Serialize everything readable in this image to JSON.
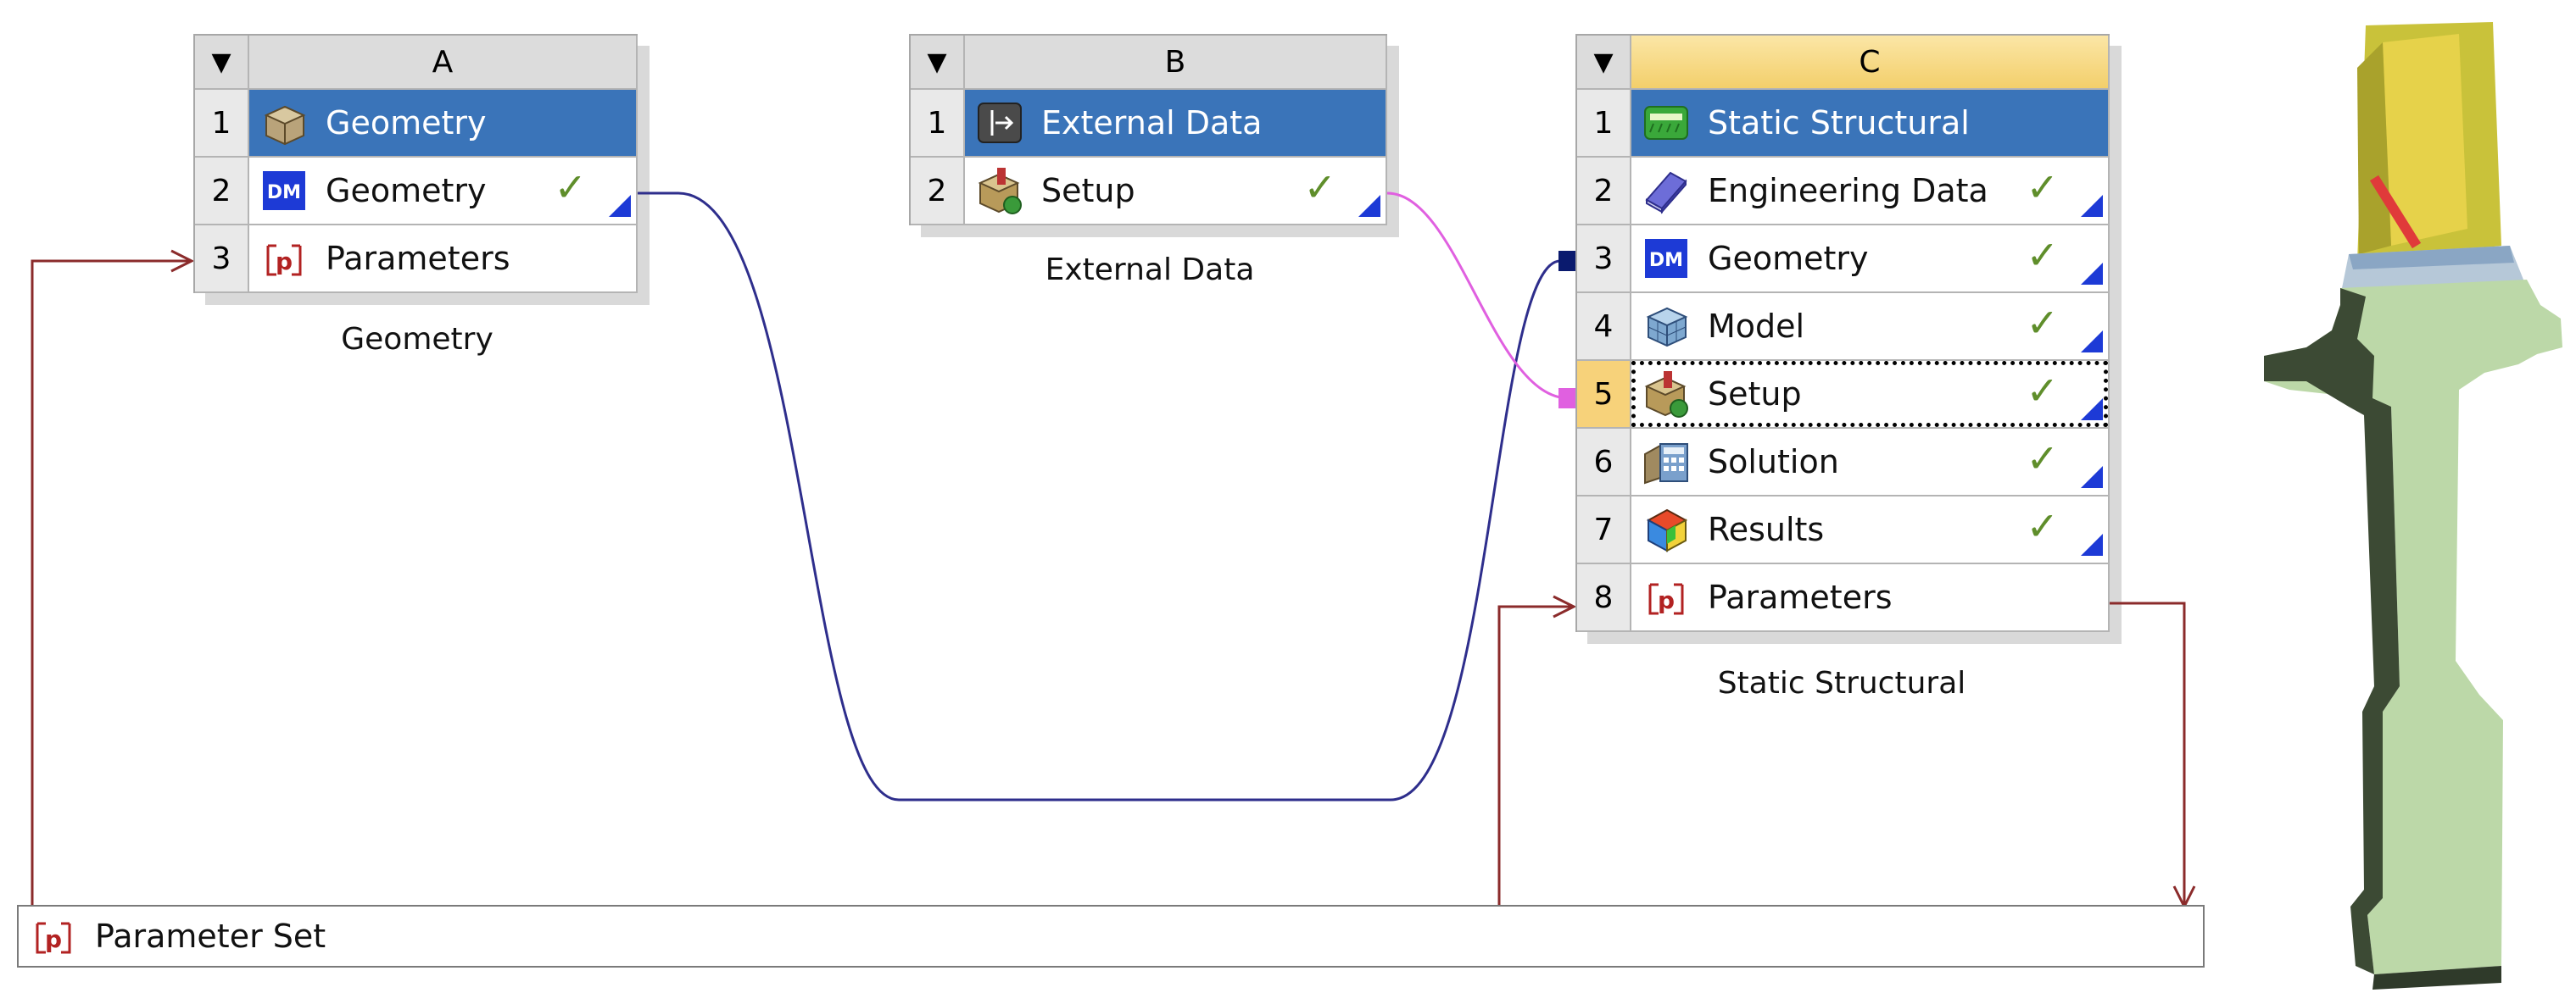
{
  "systems": {
    "a": {
      "letter": "A",
      "caption": "Geometry",
      "rows": [
        {
          "num": "1",
          "label": "Geometry",
          "icon": "geometry-box-icon"
        },
        {
          "num": "2",
          "label": "Geometry",
          "icon": "designmodeler-dm-icon",
          "status": "✓"
        },
        {
          "num": "3",
          "label": "Parameters",
          "icon": "parameters-icon"
        }
      ]
    },
    "b": {
      "letter": "B",
      "caption": "External Data",
      "rows": [
        {
          "num": "1",
          "label": "External Data",
          "icon": "external-data-icon"
        },
        {
          "num": "2",
          "label": "Setup",
          "icon": "setup-icon",
          "status": "✓"
        }
      ]
    },
    "c": {
      "letter": "C",
      "caption": "Static Structural",
      "rows": [
        {
          "num": "1",
          "label": "Static Structural",
          "icon": "static-structural-icon"
        },
        {
          "num": "2",
          "label": "Engineering Data",
          "icon": "engineering-data-book-icon",
          "status": "✓"
        },
        {
          "num": "3",
          "label": "Geometry",
          "icon": "designmodeler-dm-icon",
          "status": "✓"
        },
        {
          "num": "4",
          "label": "Model",
          "icon": "model-mesh-icon",
          "status": "✓"
        },
        {
          "num": "5",
          "label": "Setup",
          "icon": "setup-icon",
          "status": "✓"
        },
        {
          "num": "6",
          "label": "Solution",
          "icon": "solution-calculator-icon",
          "status": "✓"
        },
        {
          "num": "7",
          "label": "Results",
          "icon": "results-cube-icon",
          "status": "✓"
        },
        {
          "num": "8",
          "label": "Parameters",
          "icon": "parameters-icon"
        }
      ]
    }
  },
  "parameter_set": {
    "label": "Parameter Set",
    "icon": "parameters-icon"
  },
  "dropdown_glyph": "▼",
  "colors": {
    "selected_row": "#3a74b9",
    "active_header": "#f3cf6b",
    "check": "#5f8e2b",
    "geometry_link": "#2e2e8c",
    "data_link": "#e060e0",
    "parameter_link": "#8b2b2b",
    "turbine_body": "#bcd8a8",
    "blade": "#e6d24a"
  }
}
